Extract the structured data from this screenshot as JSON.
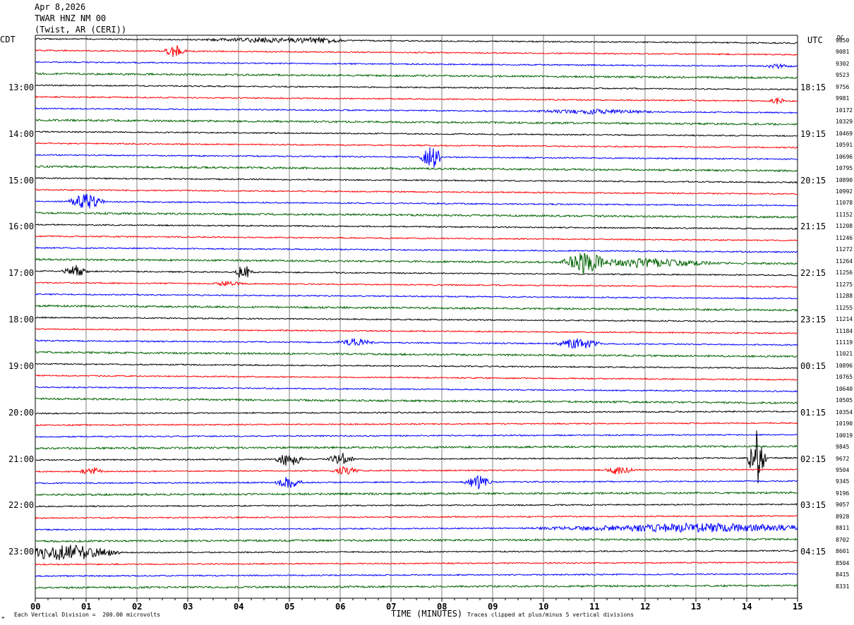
{
  "header": {
    "date": "Apr 8,2026",
    "station": "TWAR HNZ NM 00",
    "location": "(Twist, AR (CERI))"
  },
  "left_zone": "CDT",
  "right_zone": "UTC",
  "dc_header": "DC",
  "footer": {
    "scale_note": "Each Vertical Division =  200.00 microvolts",
    "xlabel": "TIME (MINUTES)",
    "clip_note": "Traces clipped at plus/minus 5 vertical divisions",
    "corner_mark": "⌖"
  },
  "colors": {
    "trace_cycle": [
      "#000000",
      "#ff0000",
      "#0000ff",
      "#006400"
    ],
    "grid": "#808080",
    "axis": "#000000"
  },
  "chart_data": {
    "type": "line",
    "title": "TWAR HNZ NM 00",
    "xlabel": "TIME (MINUTES)",
    "ylabel": "",
    "xlim": [
      0,
      15
    ],
    "x_ticks": [
      "00",
      "01",
      "02",
      "03",
      "04",
      "05",
      "06",
      "07",
      "08",
      "09",
      "10",
      "11",
      "12",
      "13",
      "14",
      "15"
    ],
    "row_count": 48,
    "left_time_labels": [
      {
        "row": 4,
        "label": "13:00"
      },
      {
        "row": 8,
        "label": "14:00"
      },
      {
        "row": 12,
        "label": "15:00"
      },
      {
        "row": 16,
        "label": "16:00"
      },
      {
        "row": 20,
        "label": "17:00"
      },
      {
        "row": 24,
        "label": "18:00"
      },
      {
        "row": 28,
        "label": "19:00"
      },
      {
        "row": 32,
        "label": "20:00"
      },
      {
        "row": 36,
        "label": "21:00"
      },
      {
        "row": 40,
        "label": "22:00"
      },
      {
        "row": 44,
        "label": "23:00"
      }
    ],
    "right_time_labels": [
      {
        "row": 4,
        "label": "18:15"
      },
      {
        "row": 8,
        "label": "19:15"
      },
      {
        "row": 12,
        "label": "20:15"
      },
      {
        "row": 16,
        "label": "21:15"
      },
      {
        "row": 20,
        "label": "22:15"
      },
      {
        "row": 24,
        "label": "23:15"
      },
      {
        "row": 28,
        "label": "00:15"
      },
      {
        "row": 32,
        "label": "01:15"
      },
      {
        "row": 36,
        "label": "02:15"
      },
      {
        "row": 40,
        "label": "03:15"
      },
      {
        "row": 44,
        "label": "04:15"
      }
    ],
    "dc_offsets": [
      "9850",
      "9081",
      "9302",
      "9523",
      "9756",
      "9981",
      "10172",
      "10329",
      "10469",
      "10591",
      "10696",
      "10795",
      "10890",
      "10992",
      "11078",
      "11152",
      "11208",
      "11246",
      "11272",
      "11264",
      "11256",
      "11275",
      "11288",
      "11255",
      "11214",
      "11184",
      "11119",
      "11021",
      "10896",
      "10765",
      "10640",
      "10505",
      "10354",
      "10190",
      "10019",
      "9845",
      "9672",
      "9504",
      "9345",
      "9196",
      "9057",
      "8928",
      "8811",
      "8702",
      "8601",
      "8504",
      "8415",
      "8331"
    ],
    "events": [
      {
        "row": 0,
        "x": 4.6,
        "amp": 3,
        "width": 1.5
      },
      {
        "row": 0,
        "x": 5.6,
        "amp": 3,
        "width": 0.6
      },
      {
        "row": 1,
        "x": 2.75,
        "amp": 10,
        "width": 0.25
      },
      {
        "row": 2,
        "x": 14.6,
        "amp": 3,
        "width": 0.3
      },
      {
        "row": 5,
        "x": 14.6,
        "amp": 8,
        "width": 0.15
      },
      {
        "row": 6,
        "x": 11.0,
        "amp": 3,
        "width": 1.3
      },
      {
        "row": 10,
        "x": 7.8,
        "amp": 18,
        "width": 0.25
      },
      {
        "row": 14,
        "x": 1.0,
        "amp": 12,
        "width": 0.4
      },
      {
        "row": 19,
        "x": 10.8,
        "amp": 14,
        "width": 0.5
      },
      {
        "row": 19,
        "x": 12.0,
        "amp": 6,
        "width": 1.5
      },
      {
        "row": 20,
        "x": 0.8,
        "amp": 8,
        "width": 0.3
      },
      {
        "row": 20,
        "x": 4.1,
        "amp": 12,
        "width": 0.2
      },
      {
        "row": 21,
        "x": 3.8,
        "amp": 4,
        "width": 0.3
      },
      {
        "row": 26,
        "x": 6.3,
        "amp": 6,
        "width": 0.4
      },
      {
        "row": 26,
        "x": 10.7,
        "amp": 8,
        "width": 0.5
      },
      {
        "row": 36,
        "x": 5.0,
        "amp": 12,
        "width": 0.3
      },
      {
        "row": 36,
        "x": 6.0,
        "amp": 10,
        "width": 0.3
      },
      {
        "row": 36,
        "x": 14.2,
        "amp": 40,
        "width": 0.2
      },
      {
        "row": 37,
        "x": 1.1,
        "amp": 8,
        "width": 0.25
      },
      {
        "row": 37,
        "x": 6.1,
        "amp": 6,
        "width": 0.3
      },
      {
        "row": 37,
        "x": 11.5,
        "amp": 8,
        "width": 0.3
      },
      {
        "row": 38,
        "x": 5.0,
        "amp": 10,
        "width": 0.3
      },
      {
        "row": 38,
        "x": 8.7,
        "amp": 10,
        "width": 0.3
      },
      {
        "row": 42,
        "x": 13.0,
        "amp": 6,
        "width": 3.5
      },
      {
        "row": 44,
        "x": 0.6,
        "amp": 12,
        "width": 1.2
      }
    ]
  }
}
